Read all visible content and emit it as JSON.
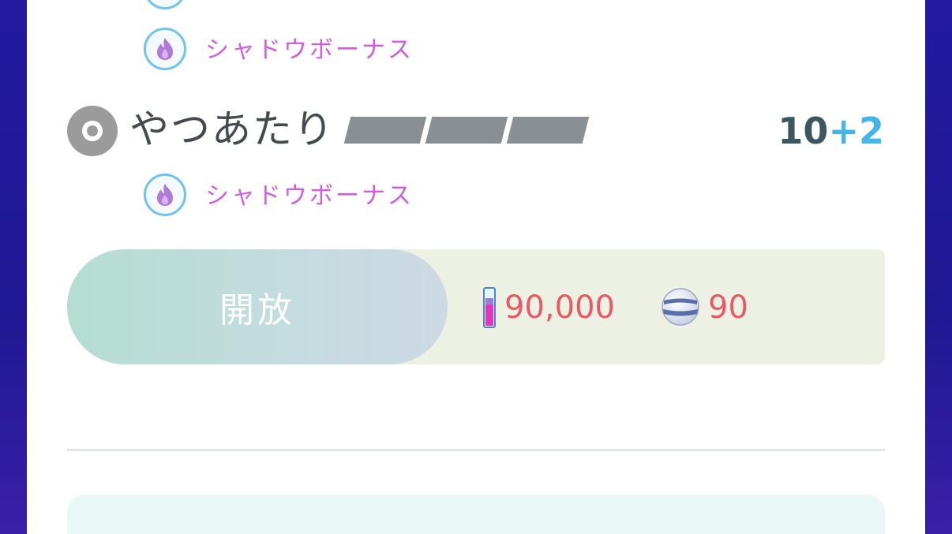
{
  "bonus_rows": [
    {
      "label": "シャドウボーナス"
    },
    {
      "label": "シャドウボーナス"
    }
  ],
  "move": {
    "name": "やつあたり",
    "energy_segments": 3,
    "power_base": "10",
    "power_bonus": "+2",
    "type_icon": "normal-type-icon"
  },
  "unlock": {
    "button_label": "開放",
    "stardust_cost": "90,000",
    "candy_cost": "90",
    "stardust_icon": "stardust-icon",
    "candy_icon": "candy-icon"
  },
  "colors": {
    "bonus_text": "#d05ce0",
    "power_base": "#3e5660",
    "power_bonus": "#45b5e8",
    "cost_text": "#e85a63",
    "background": "#231aa0"
  }
}
